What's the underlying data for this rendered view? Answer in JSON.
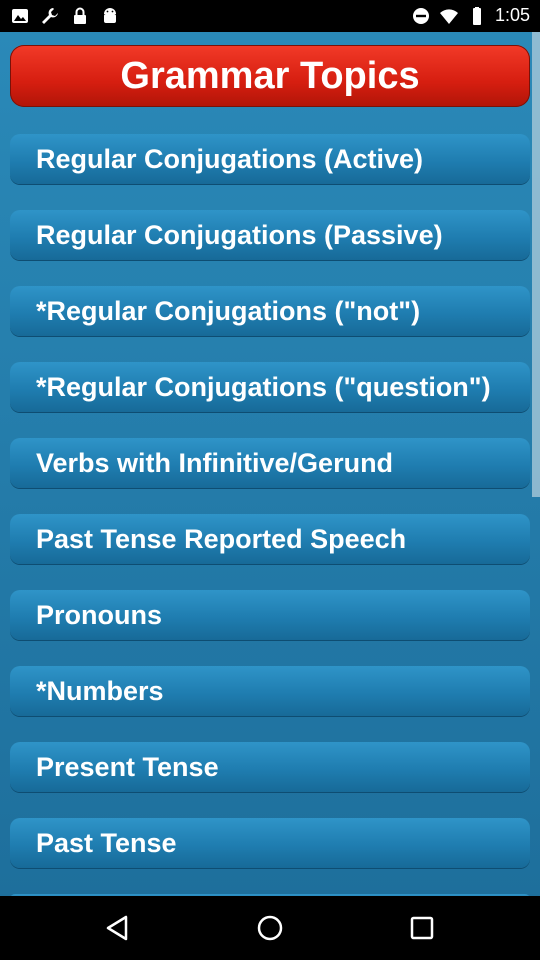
{
  "status_bar": {
    "time": "1:05",
    "left_icons": [
      "image-icon",
      "wrench-icon",
      "lock-icon",
      "android-icon"
    ],
    "right_icons": [
      "do-not-disturb-icon",
      "wifi-icon",
      "battery-icon"
    ]
  },
  "title": "Grammar Topics",
  "topics": [
    {
      "label": "Regular Conjugations (Active)"
    },
    {
      "label": "Regular Conjugations (Passive)"
    },
    {
      "label": "*Regular Conjugations (\"not\")"
    },
    {
      "label": "*Regular Conjugations (\"question\")"
    },
    {
      "label": "Verbs with Infinitive/Gerund"
    },
    {
      "label": "Past Tense Reported Speech"
    },
    {
      "label": "Pronouns"
    },
    {
      "label": "*Numbers"
    },
    {
      "label": "Present Tense"
    },
    {
      "label": "Past Tense"
    }
  ],
  "nav_bar": {
    "buttons": [
      "back-icon",
      "home-icon",
      "recents-icon"
    ]
  }
}
